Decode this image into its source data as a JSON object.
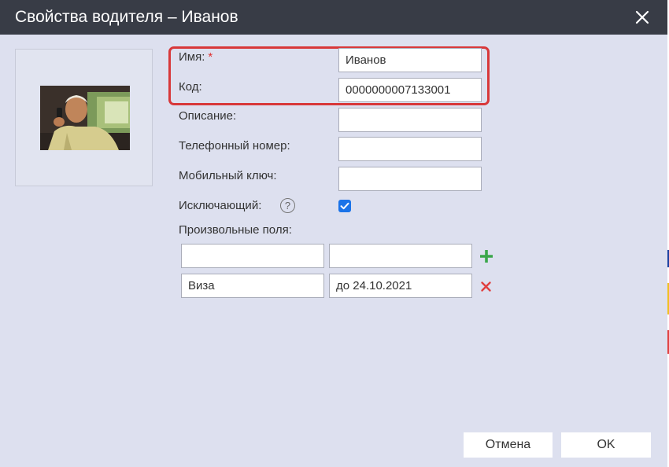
{
  "window": {
    "title": "Свойства водителя – Иванов"
  },
  "form": {
    "name_label": "Имя:",
    "name_required_mark": "*",
    "name_value": "Иванов",
    "code_label": "Код:",
    "code_value": "0000000007133001",
    "description_label": "Описание:",
    "description_value": "",
    "phone_label": "Телефонный номер:",
    "phone_value": "",
    "mobile_key_label": "Мобильный ключ:",
    "mobile_key_value": "",
    "exclusive_label": "Исключающий:",
    "exclusive_help": "?",
    "exclusive_checked": true,
    "custom_fields_label": "Произвольные поля:"
  },
  "custom_fields": {
    "new_row": {
      "name": "",
      "value": ""
    },
    "rows": [
      {
        "name": "Виза",
        "value": "до 24.10.2021"
      }
    ]
  },
  "buttons": {
    "cancel": "Отмена",
    "ok": "OK"
  },
  "colors": {
    "titlebar": "#383c46",
    "dialog_bg": "#dde0ef",
    "highlight": "#d8383a",
    "checkbox": "#1a73e8",
    "add": "#3aa64a",
    "remove": "#e04040"
  },
  "icons": {
    "close": "close-icon",
    "help": "help-icon",
    "add": "plus-icon",
    "remove": "remove-icon"
  }
}
